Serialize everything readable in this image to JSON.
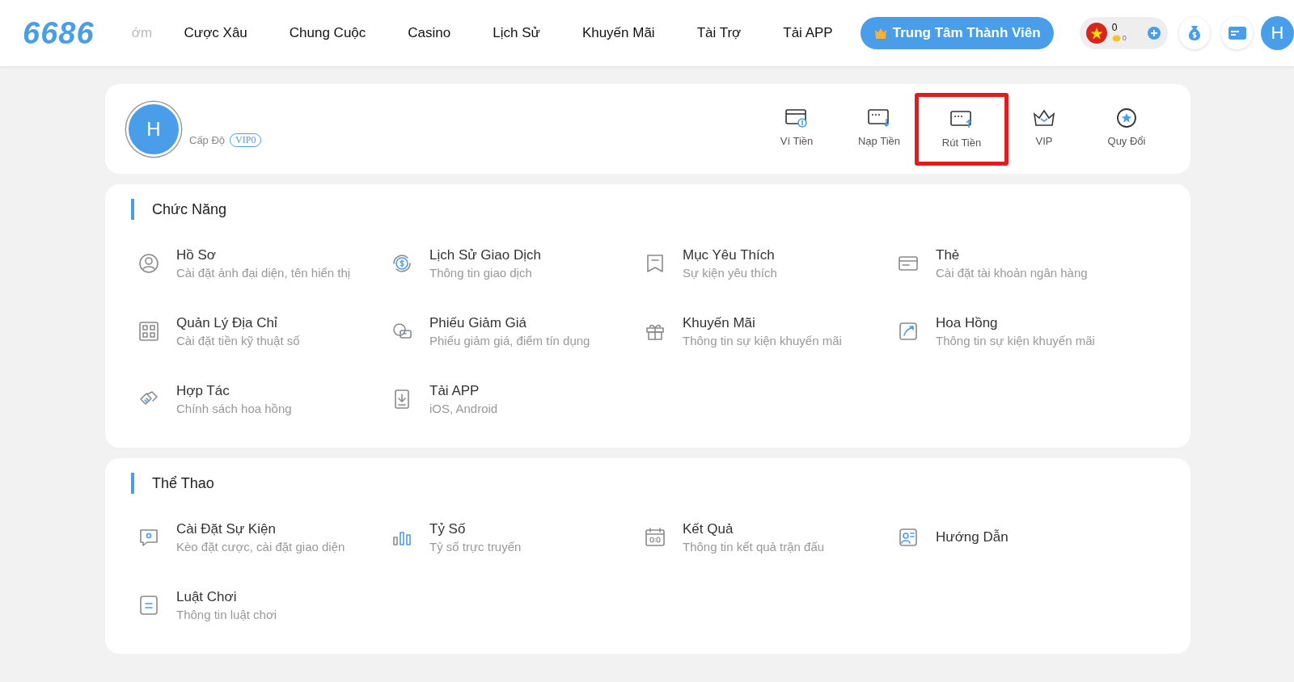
{
  "header": {
    "logo": "6686",
    "marquee_fragment": "ớm",
    "nav": [
      "Cược Xâu",
      "Chung Cuộc",
      "Casino",
      "Lịch Sử",
      "Khuyến Mãi",
      "Tài Trợ",
      "Tải APP"
    ],
    "member_button": "Trung Tâm Thành Viên",
    "balance": "0",
    "coins": "0",
    "avatar_letter": "H"
  },
  "profile": {
    "avatar_letter": "H",
    "level_label": "Cấp Độ",
    "level_badge": "VIP0",
    "actions": [
      {
        "label": "Ví Tiền",
        "highlighted": false
      },
      {
        "label": "Nạp Tiền",
        "highlighted": false
      },
      {
        "label": "Rút Tiền",
        "highlighted": true
      },
      {
        "label": "VIP",
        "highlighted": false
      },
      {
        "label": "Quy Đổi",
        "highlighted": false
      }
    ]
  },
  "sections": [
    {
      "title": "Chức Năng",
      "items": [
        {
          "title": "Hồ Sơ",
          "subtitle": "Cài đặt ảnh đại diện, tên hiển thị"
        },
        {
          "title": "Lịch Sử Giao Dịch",
          "subtitle": "Thông tin giao dịch"
        },
        {
          "title": "Mục Yêu Thích",
          "subtitle": "Sự kiện yêu thích"
        },
        {
          "title": "Thẻ",
          "subtitle": "Cài đặt tài khoản ngân hàng"
        },
        {
          "title": "Quản Lý Địa Chỉ",
          "subtitle": "Cài đặt tiền kỹ thuật số"
        },
        {
          "title": "Phiếu Giảm Giá",
          "subtitle": "Phiếu giảm giá, điểm tín dụng"
        },
        {
          "title": "Khuyến Mãi",
          "subtitle": "Thông tin sự kiện khuyến mãi"
        },
        {
          "title": "Hoa Hồng",
          "subtitle": "Thông tin sự kiện khuyến mãi"
        },
        {
          "title": "Hợp Tác",
          "subtitle": "Chính sách hoa hồng"
        },
        {
          "title": "Tải APP",
          "subtitle": "iOS, Android"
        }
      ]
    },
    {
      "title": "Thể Thao",
      "items": [
        {
          "title": "Cài Đặt Sự Kiện",
          "subtitle": "Kèo đặt cược, cài đặt giao diện"
        },
        {
          "title": "Tỷ Số",
          "subtitle": "Tỷ số trực truyến"
        },
        {
          "title": "Kết Quả",
          "subtitle": "Thông tin kết quả trận đấu"
        },
        {
          "title": "Hướng Dẫn"
        },
        {
          "title": "Luật Chơi",
          "subtitle": "Thông tin luật chơi"
        }
      ]
    }
  ]
}
